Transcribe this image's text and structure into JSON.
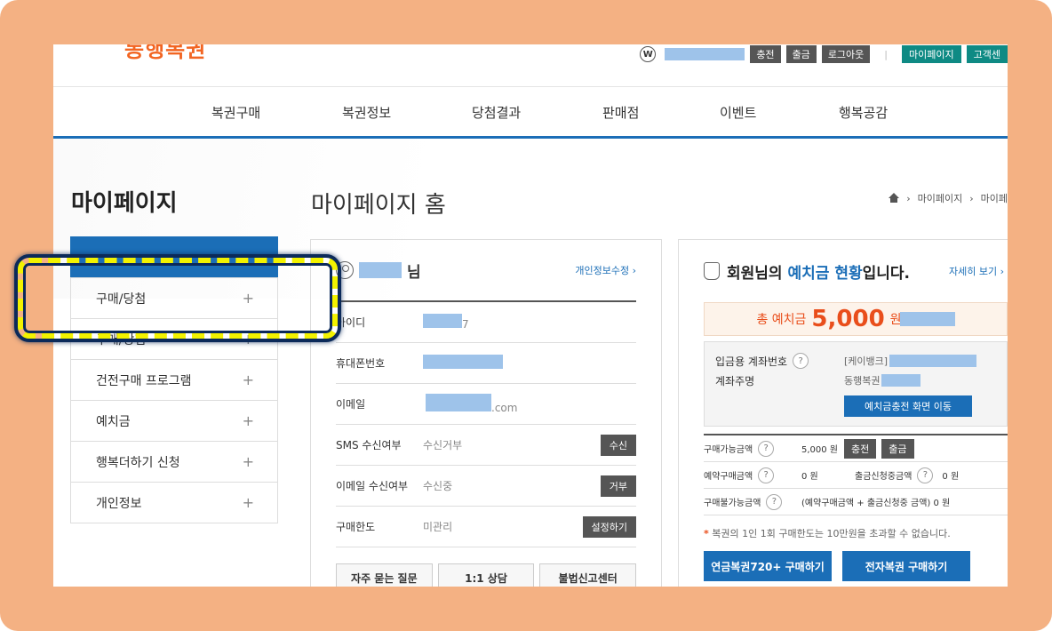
{
  "header": {
    "logo_text": "동행복권",
    "util": {
      "charge": "충전",
      "withdraw": "출금",
      "logout": "로그아웃",
      "mypage": "마이페이지",
      "customer": "고객센"
    }
  },
  "gnb": [
    "복권구매",
    "복권정보",
    "당첨결과",
    "판매점",
    "이벤트",
    "행복공감"
  ],
  "sidebar": {
    "title": "마이페이지",
    "items": [
      {
        "label": "구매/당첨"
      },
      {
        "label": "구매/당첨"
      },
      {
        "label": "건전구매 프로그램"
      },
      {
        "label": "예치금"
      },
      {
        "label": "행복더하기 신청"
      },
      {
        "label": "개인정보"
      }
    ]
  },
  "main": {
    "title": "마이페이지 홈",
    "breadcrumb": [
      "마이페이지",
      "마이페"
    ]
  },
  "profile": {
    "name_suffix": "님",
    "edit_link": "개인정보수정",
    "rows": [
      {
        "label": "아이디",
        "value": "7"
      },
      {
        "label": "휴대폰번호",
        "value": ""
      },
      {
        "label": "이메일",
        "value": ".com"
      },
      {
        "label": "SMS 수신여부",
        "value": "수신거부",
        "button": "수신"
      },
      {
        "label": "이메일 수신여부",
        "value": "수신중",
        "button": "거부"
      },
      {
        "label": "구매한도",
        "value": "미관리",
        "button": "설정하기"
      }
    ],
    "buttons": [
      "자주 묻는 질문",
      "1:1 상담",
      "불법신고센터"
    ]
  },
  "deposit": {
    "title_pre": "회원님의 ",
    "title_em": "예치금 현황",
    "title_post": "입니다.",
    "more": "자세히 보기",
    "total_label": "총 예치금",
    "total_value": "5,000",
    "total_unit": "원",
    "account_label": "입금용 계좌번호",
    "account_value": "[케이뱅크]",
    "holder_label": "계좌주명",
    "holder_value": "동행복권",
    "charge_screen_btn": "예치금충전 화면 이동",
    "purchasable_label": "구매가능금액",
    "purchasable_value": "5,000 원",
    "charge_btn": "충전",
    "withdraw_btn": "출금",
    "reserved_label": "예약구매금액",
    "reserved_value": "0 원",
    "withdraw_req_label": "출금신청중금액",
    "withdraw_req_value": "0 원",
    "unavailable_label": "구매불가능금액",
    "unavailable_value": "(예약구매금액 + 출금신청중 금액)  0 원",
    "note": "복권의 1인 1회 구매한도는 10만원을 초과할 수 없습니다.",
    "btn1": "연금복권720+ 구매하기",
    "btn2": "전자복권 구매하기"
  }
}
